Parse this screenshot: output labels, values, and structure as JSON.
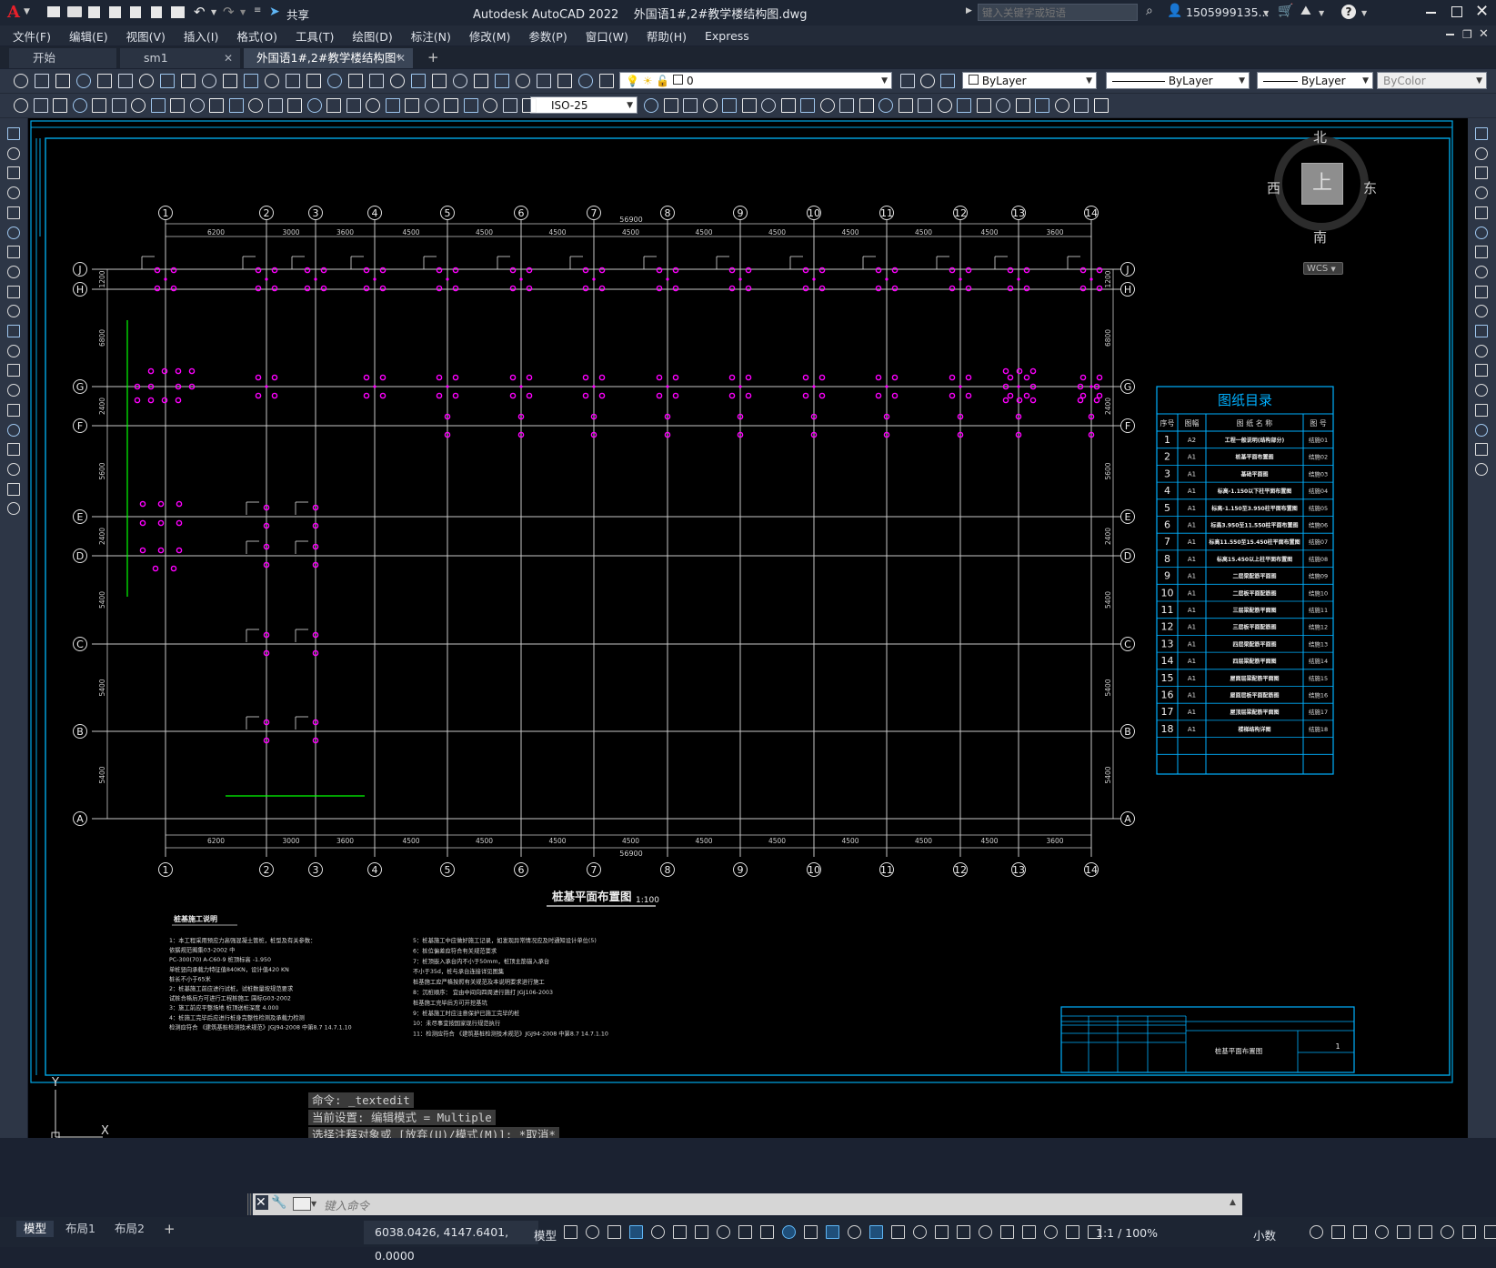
{
  "app": {
    "title": "Autodesk AutoCAD 2022    外国语1#,2#教学楼结构图.dwg",
    "share_label": "共享",
    "search_placeholder": "键入关键字或短语",
    "user": "1505999135...",
    "window_controls": [
      "minimize-icon",
      "maximize-icon",
      "close-icon"
    ]
  },
  "menu": [
    "文件(F)",
    "编辑(E)",
    "视图(V)",
    "插入(I)",
    "格式(O)",
    "工具(T)",
    "绘图(D)",
    "标注(N)",
    "修改(M)",
    "参数(P)",
    "窗口(W)",
    "帮助(H)",
    "Express"
  ],
  "tabs": [
    {
      "label": "开始",
      "active": false
    },
    {
      "label": "sm1",
      "active": false,
      "closable": true
    },
    {
      "label": "外国语1#,2#教学楼结构图*",
      "active": true,
      "closable": true
    }
  ],
  "toolbar": {
    "layer_value": "0",
    "color_value": "ByLayer",
    "linetype_value": "ByLayer",
    "lineweight_value": "ByLayer",
    "plotstyle_value": "ByColor",
    "dimstyle_value": "ISO-25"
  },
  "viewcube": {
    "north": "北",
    "south": "南",
    "east": "东",
    "west": "西",
    "top": "上",
    "wcs": "WCS"
  },
  "plan": {
    "grid_numbers": [
      "1",
      "2",
      "3",
      "4",
      "5",
      "6",
      "7",
      "8",
      "9",
      "10",
      "11",
      "12",
      "13",
      "14"
    ],
    "grid_letters": [
      "J",
      "H",
      "G",
      "F",
      "E",
      "D",
      "C",
      "B",
      "A"
    ],
    "bay_dims": [
      "6200",
      "3000",
      "3600",
      "4500",
      "4500",
      "4500",
      "4500",
      "4500",
      "4500",
      "4500",
      "4500",
      "4500",
      "3600",
      "4500"
    ],
    "total_dim": "56900",
    "left_dims": [
      "1200",
      "6800",
      "2400",
      "5600",
      "2400",
      "5400",
      "5400",
      "5400"
    ],
    "title": "桩基平面布置图",
    "scale": "1:100"
  },
  "catalog": {
    "title": "图纸目录",
    "headers": [
      "序号",
      "图幅",
      "图 纸 名 称",
      "图 号"
    ],
    "rows": [
      {
        "no": "1",
        "size": "A2",
        "name": "工程一般说明(结构部分)",
        "code": "结施01"
      },
      {
        "no": "2",
        "size": "A1",
        "name": "桩基平面布置图",
        "code": "结施02"
      },
      {
        "no": "3",
        "size": "A1",
        "name": "基础平面图",
        "code": "结施03"
      },
      {
        "no": "4",
        "size": "A1",
        "name": "标高-1.150以下柱平面布置图",
        "code": "结施04"
      },
      {
        "no": "5",
        "size": "A1",
        "name": "标高-1.150至3.950柱平面布置图",
        "code": "结施05"
      },
      {
        "no": "6",
        "size": "A1",
        "name": "标高3.950至11.550柱平面布置图",
        "code": "结施06"
      },
      {
        "no": "7",
        "size": "A1",
        "name": "标高11.550至15.450柱平面布置图",
        "code": "结施07"
      },
      {
        "no": "8",
        "size": "A1",
        "name": "标高15.450以上柱平面布置图",
        "code": "结施08"
      },
      {
        "no": "9",
        "size": "A1",
        "name": "二层梁配筋平面图",
        "code": "结施09"
      },
      {
        "no": "10",
        "size": "A1",
        "name": "二层板平面配筋图",
        "code": "结施10"
      },
      {
        "no": "11",
        "size": "A1",
        "name": "三层梁配筋平面图",
        "code": "结施11"
      },
      {
        "no": "12",
        "size": "A1",
        "name": "三层板平面配筋图",
        "code": "结施12"
      },
      {
        "no": "13",
        "size": "A1",
        "name": "四层梁配筋平面图",
        "code": "结施13"
      },
      {
        "no": "14",
        "size": "A1",
        "name": "四层梁配筋平面图",
        "code": "结施14"
      },
      {
        "no": "15",
        "size": "A1",
        "name": "屋面层梁配筋平面图",
        "code": "结施15"
      },
      {
        "no": "16",
        "size": "A1",
        "name": "屋面层板平面配筋图",
        "code": "结施16"
      },
      {
        "no": "17",
        "size": "A1",
        "name": "屋顶层梁配筋平面图",
        "code": "结施17"
      },
      {
        "no": "18",
        "size": "A1",
        "name": "楼梯结构详图",
        "code": "结施18"
      }
    ]
  },
  "notes": {
    "heading": "桩基施工说明",
    "left": [
      "1：本工程采用预应力高强混凝土管桩，桩型及有关参数：",
      "   依据规范图集03-2002 中",
      "   PC-300(70) A-C60-9   桩顶标高  -1.950",
      "   单桩竖向承载力特征值840KN，设计值420  KN",
      "   桩长不小于65米",
      "2：桩基施工前应进行试桩，试桩数量按规范要求",
      "   试桩合格后方可进行工程桩施工      国标G03-2002",
      "3：施工前应平整场地     桩顶送桩深度    4.000",
      "4：桩施工完毕后应进行桩身完整性检测及承载力检测",
      "   检测应符合 《建筑基桩检测技术规范》JGJ94-2008 中第8.7   14.7.1.10"
    ],
    "right": [
      "5：桩基施工中应做好施工记录，如发现异常情况应及时通知设计单位(5)",
      "6：桩位偏差应符合有关规范要求",
      "7：桩顶嵌入承台内不小于50mm，桩顶主筋锚入承台",
      "   不小于35d，桩与承台连接详见图集",
      "   桩基施工应严格按照有关规范及本说明要求进行施工",
      "8：沉桩顺序：    宜由中间向四周进行施打   JGJ106-2003",
      "   桩基施工完毕后方可开挖基坑",
      "9：桩基施工时应注意保护已施工完毕的桩",
      "10：未尽事宜按国家现行规范执行",
      "11：检测应符合 《建筑基桩检测技术规范》JGJ94-2008 中第8.7    14.7.1.10"
    ]
  },
  "titleblock": {
    "name": "桩基平面布置图",
    "sheet": "1"
  },
  "ucs": {
    "y": "Y",
    "x": "X"
  },
  "command": {
    "history": [
      "命令: _textedit",
      "当前设置: 编辑模式 = Multiple",
      "选择注释对象或 [放弃(U)/模式(M)]: *取消*"
    ],
    "placeholder": "键入命令"
  },
  "status": {
    "model_tabs": [
      "模型",
      "布局1",
      "布局2"
    ],
    "coordinates": "6038.0426, 4147.6401, 0.0000",
    "space": "模型",
    "scale": "1:1 / 100%",
    "units": "小数"
  },
  "colors": {
    "accent": "#00b0ff",
    "grid": "#c8c8c8",
    "pile": "#ff00ff",
    "green": "#00ff00",
    "background": "#000000"
  }
}
